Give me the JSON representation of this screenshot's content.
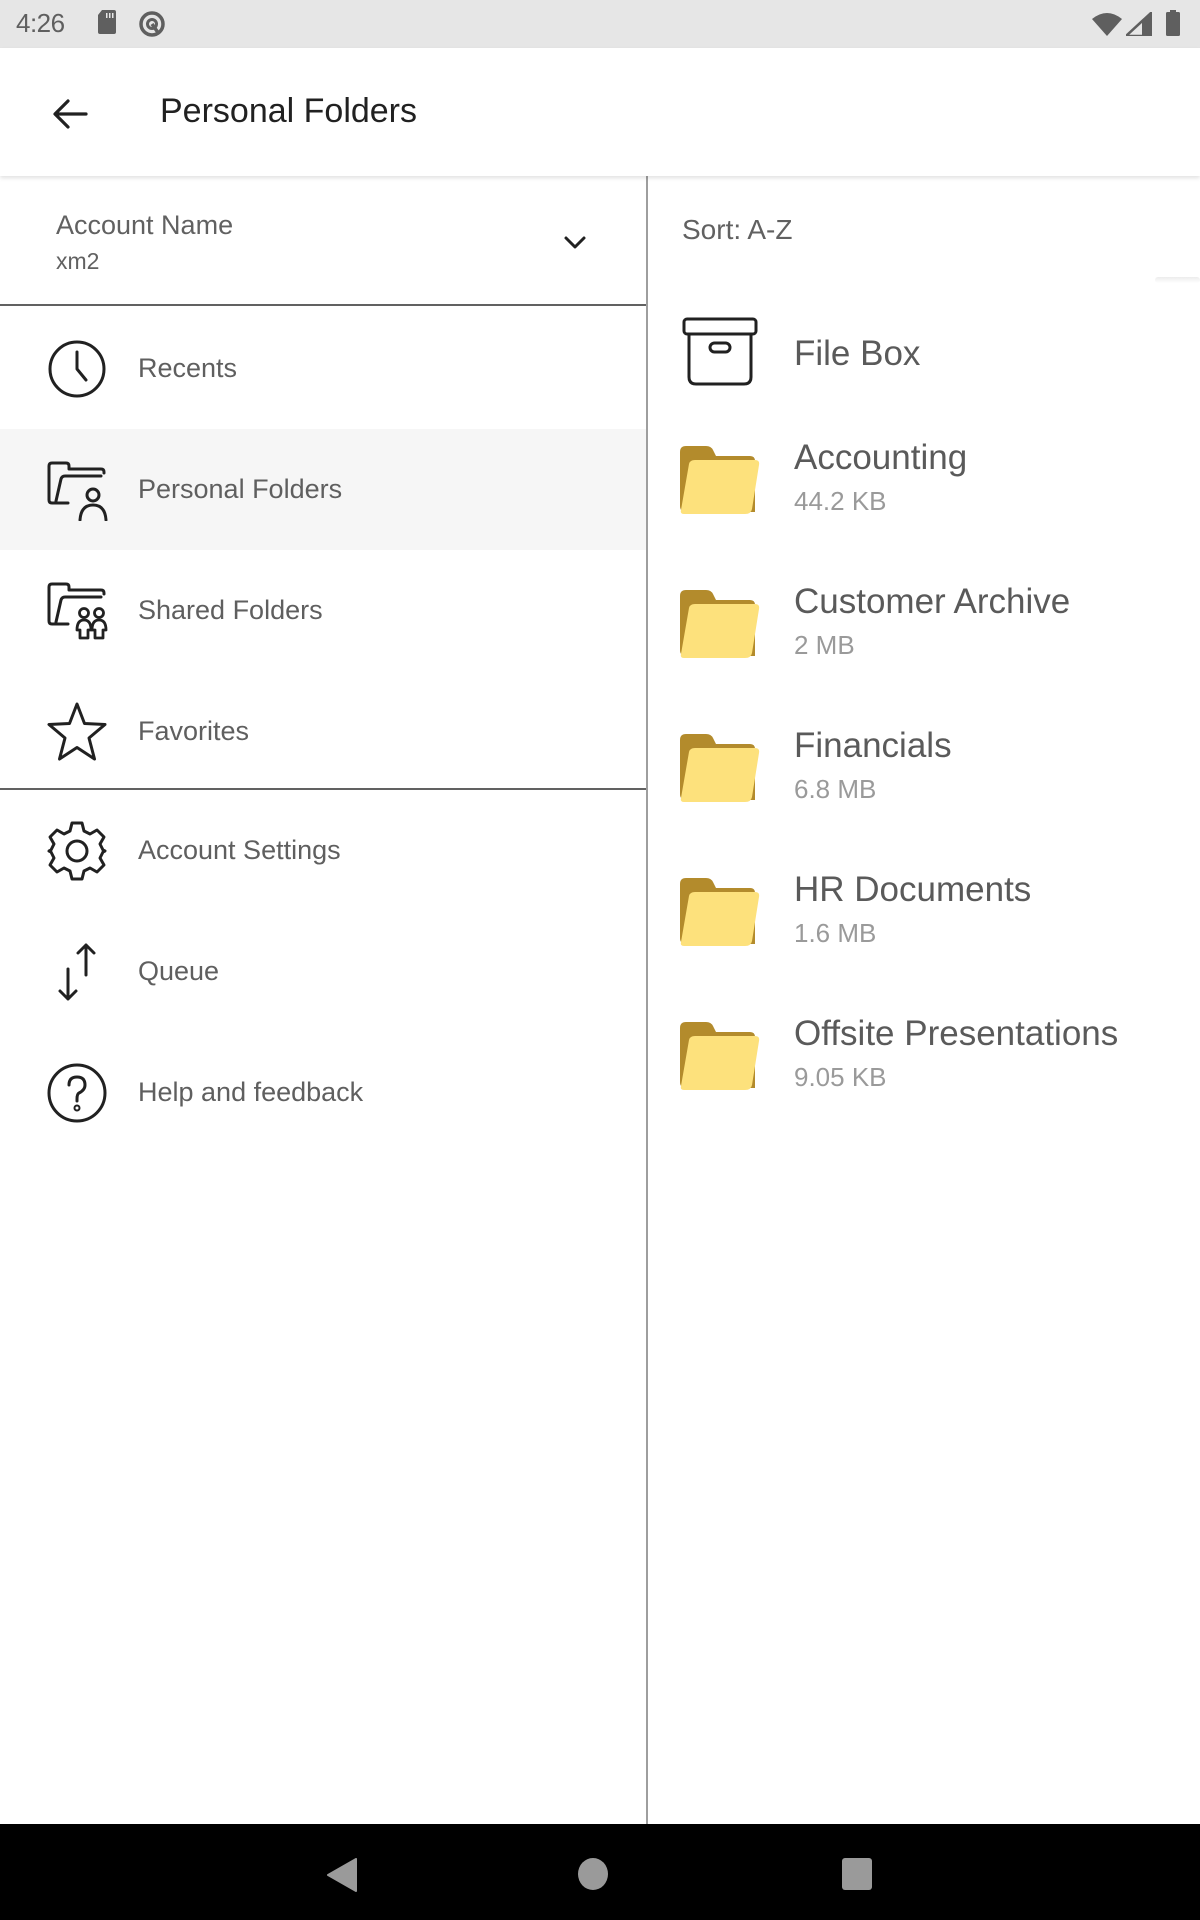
{
  "status_bar": {
    "time": "4:26",
    "icons": [
      "sd-card-icon",
      "data-saver-icon",
      "wifi-icon",
      "signal-icon",
      "battery-icon"
    ]
  },
  "app_bar": {
    "back_icon": "arrow-left-icon",
    "title": "Personal Folders"
  },
  "drawer": {
    "account": {
      "label": "Account Name",
      "value": "xm2",
      "chevron_icon": "chevron-down-icon"
    },
    "primary_items": [
      {
        "label": "Recents",
        "icon": "clock-icon",
        "active": false
      },
      {
        "label": "Personal Folders",
        "icon": "folder-person-icon",
        "active": true
      },
      {
        "label": "Shared Folders",
        "icon": "folder-people-icon",
        "active": false
      },
      {
        "label": "Favorites",
        "icon": "star-icon",
        "active": false
      }
    ],
    "secondary_items": [
      {
        "label": "Account Settings",
        "icon": "gear-icon"
      },
      {
        "label": "Queue",
        "icon": "transfer-arrows-icon"
      },
      {
        "label": "Help and feedback",
        "icon": "help-circle-icon"
      }
    ]
  },
  "content": {
    "sort_label": "Sort: A-Z",
    "items": [
      {
        "name": "File Box",
        "size": null,
        "type": "filebox"
      },
      {
        "name": "Accounting",
        "size": "44.2 KB",
        "type": "folder"
      },
      {
        "name": "Customer Archive",
        "size": "2 MB",
        "type": "folder"
      },
      {
        "name": "Financials",
        "size": "6.8 MB",
        "type": "folder"
      },
      {
        "name": "HR Documents",
        "size": "1.6 MB",
        "type": "folder"
      },
      {
        "name": "Offsite Presentations",
        "size": "9.05 KB",
        "type": "folder"
      }
    ]
  },
  "colors": {
    "folder_front": "#fde17c",
    "folder_back": "#b38b2c",
    "active_item_bg": "#f6f6f6"
  },
  "system_nav": {
    "back": "nav-back-icon",
    "home": "nav-home-icon",
    "recents": "nav-recents-icon"
  }
}
